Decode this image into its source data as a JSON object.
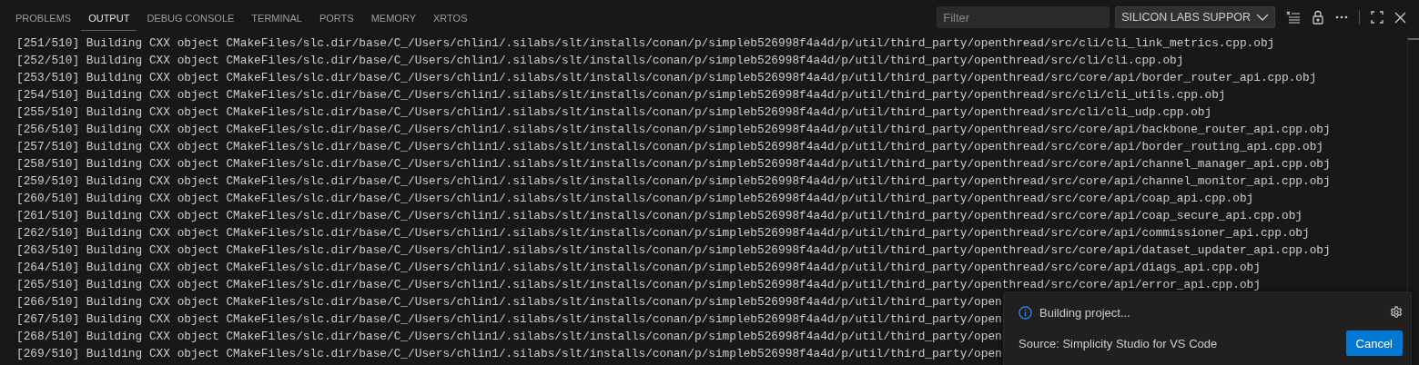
{
  "tabs": [
    {
      "label": "PROBLEMS",
      "selected": false
    },
    {
      "label": "OUTPUT",
      "selected": true
    },
    {
      "label": "DEBUG CONSOLE",
      "selected": false
    },
    {
      "label": "TERMINAL",
      "selected": false
    },
    {
      "label": "PORTS",
      "selected": false
    },
    {
      "label": "MEMORY",
      "selected": false
    },
    {
      "label": "XRTOS",
      "selected": false
    }
  ],
  "filter": {
    "placeholder": "Filter"
  },
  "channel_dropdown": {
    "value": "SILICON LABS SUPPOR"
  },
  "output_lines": [
    "[251/510] Building CXX object CMakeFiles/slc.dir/base/C_/Users/chlin1/.silabs/slt/installs/conan/p/simpleb526998f4a4d/p/util/third_party/openthread/src/cli/cli_link_metrics.cpp.obj",
    "[252/510] Building CXX object CMakeFiles/slc.dir/base/C_/Users/chlin1/.silabs/slt/installs/conan/p/simpleb526998f4a4d/p/util/third_party/openthread/src/cli/cli.cpp.obj",
    "[253/510] Building CXX object CMakeFiles/slc.dir/base/C_/Users/chlin1/.silabs/slt/installs/conan/p/simpleb526998f4a4d/p/util/third_party/openthread/src/core/api/border_router_api.cpp.obj",
    "[254/510] Building CXX object CMakeFiles/slc.dir/base/C_/Users/chlin1/.silabs/slt/installs/conan/p/simpleb526998f4a4d/p/util/third_party/openthread/src/cli/cli_utils.cpp.obj",
    "[255/510] Building CXX object CMakeFiles/slc.dir/base/C_/Users/chlin1/.silabs/slt/installs/conan/p/simpleb526998f4a4d/p/util/third_party/openthread/src/cli/cli_udp.cpp.obj",
    "[256/510] Building CXX object CMakeFiles/slc.dir/base/C_/Users/chlin1/.silabs/slt/installs/conan/p/simpleb526998f4a4d/p/util/third_party/openthread/src/core/api/backbone_router_api.cpp.obj",
    "[257/510] Building CXX object CMakeFiles/slc.dir/base/C_/Users/chlin1/.silabs/slt/installs/conan/p/simpleb526998f4a4d/p/util/third_party/openthread/src/core/api/border_routing_api.cpp.obj",
    "[258/510] Building CXX object CMakeFiles/slc.dir/base/C_/Users/chlin1/.silabs/slt/installs/conan/p/simpleb526998f4a4d/p/util/third_party/openthread/src/core/api/channel_manager_api.cpp.obj",
    "[259/510] Building CXX object CMakeFiles/slc.dir/base/C_/Users/chlin1/.silabs/slt/installs/conan/p/simpleb526998f4a4d/p/util/third_party/openthread/src/core/api/channel_monitor_api.cpp.obj",
    "[260/510] Building CXX object CMakeFiles/slc.dir/base/C_/Users/chlin1/.silabs/slt/installs/conan/p/simpleb526998f4a4d/p/util/third_party/openthread/src/core/api/coap_api.cpp.obj",
    "[261/510] Building CXX object CMakeFiles/slc.dir/base/C_/Users/chlin1/.silabs/slt/installs/conan/p/simpleb526998f4a4d/p/util/third_party/openthread/src/core/api/coap_secure_api.cpp.obj",
    "[262/510] Building CXX object CMakeFiles/slc.dir/base/C_/Users/chlin1/.silabs/slt/installs/conan/p/simpleb526998f4a4d/p/util/third_party/openthread/src/core/api/commissioner_api.cpp.obj",
    "[263/510] Building CXX object CMakeFiles/slc.dir/base/C_/Users/chlin1/.silabs/slt/installs/conan/p/simpleb526998f4a4d/p/util/third_party/openthread/src/core/api/dataset_updater_api.cpp.obj",
    "[264/510] Building CXX object CMakeFiles/slc.dir/base/C_/Users/chlin1/.silabs/slt/installs/conan/p/simpleb526998f4a4d/p/util/third_party/openthread/src/core/api/diags_api.cpp.obj",
    "[265/510] Building CXX object CMakeFiles/slc.dir/base/C_/Users/chlin1/.silabs/slt/installs/conan/p/simpleb526998f4a4d/p/util/third_party/openthread/src/core/api/error_api.cpp.obj",
    "[266/510] Building CXX object CMakeFiles/slc.dir/base/C_/Users/chlin1/.silabs/slt/installs/conan/p/simpleb526998f4a4d/p/util/third_party/open",
    "[267/510] Building CXX object CMakeFiles/slc.dir/base/C_/Users/chlin1/.silabs/slt/installs/conan/p/simpleb526998f4a4d/p/util/third_party/open",
    "[268/510] Building CXX object CMakeFiles/slc.dir/base/C_/Users/chlin1/.silabs/slt/installs/conan/p/simpleb526998f4a4d/p/util/third_party/open",
    "[269/510] Building CXX object CMakeFiles/slc.dir/base/C_/Users/chlin1/.silabs/slt/installs/conan/p/simpleb526998f4a4d/p/util/third_party/open"
  ],
  "notification": {
    "message": "Building project...",
    "source": "Source: Simplicity Studio for VS Code",
    "button": "Cancel"
  }
}
